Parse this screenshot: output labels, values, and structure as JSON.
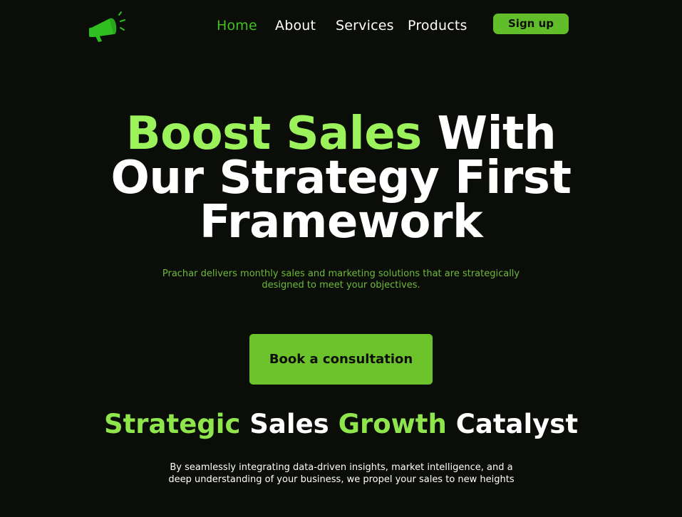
{
  "brand": {
    "logo_icon": "megaphone-icon",
    "accent_color": "#62bd2a"
  },
  "nav": {
    "home": "Home",
    "about": "About",
    "services": "Services",
    "products": "Products",
    "signup": "Sign up"
  },
  "hero": {
    "title_accent": "Boost Sales",
    "title_rest_line1": " With",
    "title_line2": "Our Strategy First",
    "title_line3": "Framework",
    "subtitle": "Prachar delivers monthly sales and marketing solutions that are strategically designed to meet your objectives.",
    "cta": "Book a consultation"
  },
  "section": {
    "title_word1": "Strategic",
    "title_word2": " Sales ",
    "title_word3": "Growth",
    "title_word4": " Catalyst",
    "description": "By seamlessly integrating data-driven insights, market intelligence, and a deep understanding of your business, we propel your sales to new heights"
  }
}
